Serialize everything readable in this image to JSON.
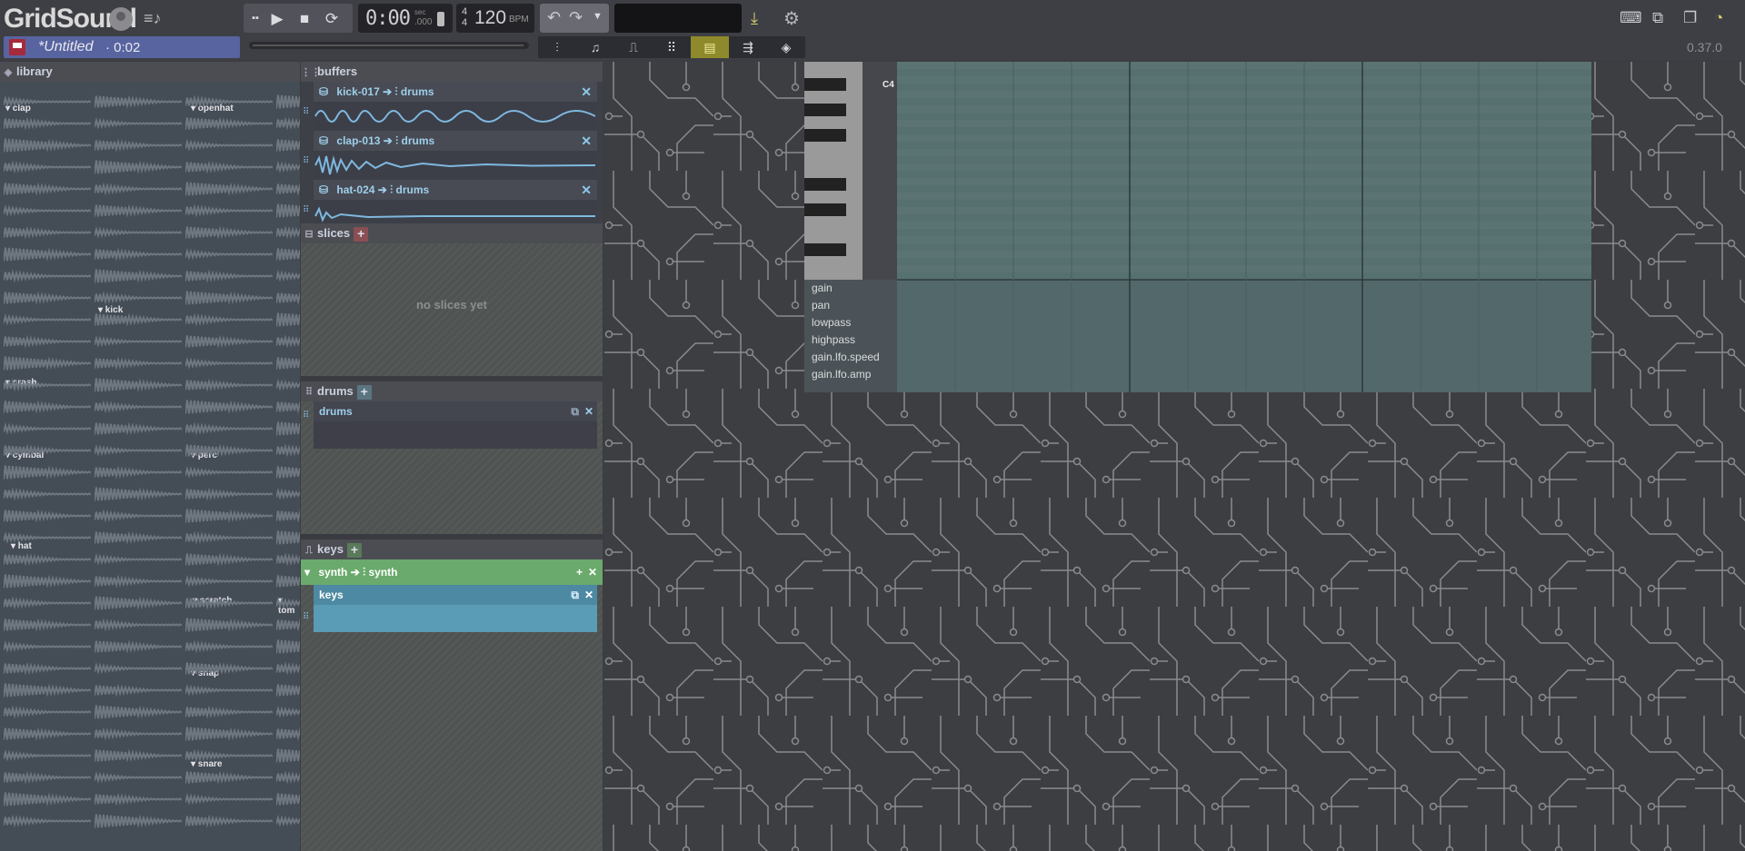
{
  "app": {
    "title": "GridSound",
    "version": "0.37.0"
  },
  "project": {
    "name": "*Untitled",
    "duration": "· 0:02"
  },
  "clock": {
    "time": "0:00",
    "sec_label": "sec",
    "ms": ".000"
  },
  "tempo": {
    "sig_top": "4",
    "sig_bottom": "4",
    "bpm": "120",
    "unit": "BPM"
  },
  "library": {
    "title": "library",
    "categories": [
      {
        "label": "clap"
      },
      {
        "label": "openhat"
      },
      {
        "label": "kick"
      },
      {
        "label": "crash"
      },
      {
        "label": "cymbal"
      },
      {
        "label": "perc"
      },
      {
        "label": "hat"
      },
      {
        "label": "scratch"
      },
      {
        "label": "tom"
      },
      {
        "label": "snap"
      },
      {
        "label": "snare"
      }
    ]
  },
  "buffers": {
    "title": "buffers",
    "items": [
      {
        "name": "kick-017",
        "dest": "drums"
      },
      {
        "name": "clap-013",
        "dest": "drums"
      },
      {
        "name": "hat-024",
        "dest": "drums"
      }
    ]
  },
  "slices": {
    "title": "slices",
    "empty": "no slices yet"
  },
  "drums": {
    "title": "drums",
    "items": [
      {
        "name": "drums"
      }
    ]
  },
  "keys": {
    "title": "keys",
    "synth": {
      "name": "synth",
      "dest": "synth"
    },
    "items": [
      {
        "name": "keys"
      }
    ]
  },
  "pianoroll": {
    "note_label": "C4",
    "automation": [
      "gain",
      "pan",
      "lowpass",
      "highpass",
      "gain.lfo.speed",
      "gain.lfo.amp"
    ]
  },
  "colors": {
    "accent": "#8e8a2c",
    "buffer_text": "#9ecfea",
    "synth_green": "#6aaa6c",
    "keys_blue": "#5a9bb5"
  }
}
